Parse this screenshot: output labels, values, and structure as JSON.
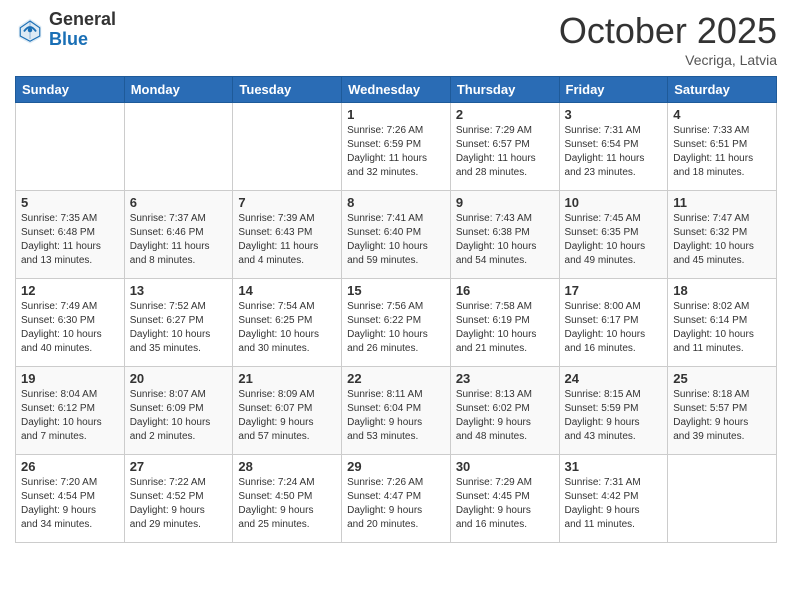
{
  "header": {
    "logo_general": "General",
    "logo_blue": "Blue",
    "month_title": "October 2025",
    "location": "Vecriga, Latvia"
  },
  "days_of_week": [
    "Sunday",
    "Monday",
    "Tuesday",
    "Wednesday",
    "Thursday",
    "Friday",
    "Saturday"
  ],
  "weeks": [
    [
      {
        "day": "",
        "info": ""
      },
      {
        "day": "",
        "info": ""
      },
      {
        "day": "",
        "info": ""
      },
      {
        "day": "1",
        "info": "Sunrise: 7:26 AM\nSunset: 6:59 PM\nDaylight: 11 hours\nand 32 minutes."
      },
      {
        "day": "2",
        "info": "Sunrise: 7:29 AM\nSunset: 6:57 PM\nDaylight: 11 hours\nand 28 minutes."
      },
      {
        "day": "3",
        "info": "Sunrise: 7:31 AM\nSunset: 6:54 PM\nDaylight: 11 hours\nand 23 minutes."
      },
      {
        "day": "4",
        "info": "Sunrise: 7:33 AM\nSunset: 6:51 PM\nDaylight: 11 hours\nand 18 minutes."
      }
    ],
    [
      {
        "day": "5",
        "info": "Sunrise: 7:35 AM\nSunset: 6:48 PM\nDaylight: 11 hours\nand 13 minutes."
      },
      {
        "day": "6",
        "info": "Sunrise: 7:37 AM\nSunset: 6:46 PM\nDaylight: 11 hours\nand 8 minutes."
      },
      {
        "day": "7",
        "info": "Sunrise: 7:39 AM\nSunset: 6:43 PM\nDaylight: 11 hours\nand 4 minutes."
      },
      {
        "day": "8",
        "info": "Sunrise: 7:41 AM\nSunset: 6:40 PM\nDaylight: 10 hours\nand 59 minutes."
      },
      {
        "day": "9",
        "info": "Sunrise: 7:43 AM\nSunset: 6:38 PM\nDaylight: 10 hours\nand 54 minutes."
      },
      {
        "day": "10",
        "info": "Sunrise: 7:45 AM\nSunset: 6:35 PM\nDaylight: 10 hours\nand 49 minutes."
      },
      {
        "day": "11",
        "info": "Sunrise: 7:47 AM\nSunset: 6:32 PM\nDaylight: 10 hours\nand 45 minutes."
      }
    ],
    [
      {
        "day": "12",
        "info": "Sunrise: 7:49 AM\nSunset: 6:30 PM\nDaylight: 10 hours\nand 40 minutes."
      },
      {
        "day": "13",
        "info": "Sunrise: 7:52 AM\nSunset: 6:27 PM\nDaylight: 10 hours\nand 35 minutes."
      },
      {
        "day": "14",
        "info": "Sunrise: 7:54 AM\nSunset: 6:25 PM\nDaylight: 10 hours\nand 30 minutes."
      },
      {
        "day": "15",
        "info": "Sunrise: 7:56 AM\nSunset: 6:22 PM\nDaylight: 10 hours\nand 26 minutes."
      },
      {
        "day": "16",
        "info": "Sunrise: 7:58 AM\nSunset: 6:19 PM\nDaylight: 10 hours\nand 21 minutes."
      },
      {
        "day": "17",
        "info": "Sunrise: 8:00 AM\nSunset: 6:17 PM\nDaylight: 10 hours\nand 16 minutes."
      },
      {
        "day": "18",
        "info": "Sunrise: 8:02 AM\nSunset: 6:14 PM\nDaylight: 10 hours\nand 11 minutes."
      }
    ],
    [
      {
        "day": "19",
        "info": "Sunrise: 8:04 AM\nSunset: 6:12 PM\nDaylight: 10 hours\nand 7 minutes."
      },
      {
        "day": "20",
        "info": "Sunrise: 8:07 AM\nSunset: 6:09 PM\nDaylight: 10 hours\nand 2 minutes."
      },
      {
        "day": "21",
        "info": "Sunrise: 8:09 AM\nSunset: 6:07 PM\nDaylight: 9 hours\nand 57 minutes."
      },
      {
        "day": "22",
        "info": "Sunrise: 8:11 AM\nSunset: 6:04 PM\nDaylight: 9 hours\nand 53 minutes."
      },
      {
        "day": "23",
        "info": "Sunrise: 8:13 AM\nSunset: 6:02 PM\nDaylight: 9 hours\nand 48 minutes."
      },
      {
        "day": "24",
        "info": "Sunrise: 8:15 AM\nSunset: 5:59 PM\nDaylight: 9 hours\nand 43 minutes."
      },
      {
        "day": "25",
        "info": "Sunrise: 8:18 AM\nSunset: 5:57 PM\nDaylight: 9 hours\nand 39 minutes."
      }
    ],
    [
      {
        "day": "26",
        "info": "Sunrise: 7:20 AM\nSunset: 4:54 PM\nDaylight: 9 hours\nand 34 minutes."
      },
      {
        "day": "27",
        "info": "Sunrise: 7:22 AM\nSunset: 4:52 PM\nDaylight: 9 hours\nand 29 minutes."
      },
      {
        "day": "28",
        "info": "Sunrise: 7:24 AM\nSunset: 4:50 PM\nDaylight: 9 hours\nand 25 minutes."
      },
      {
        "day": "29",
        "info": "Sunrise: 7:26 AM\nSunset: 4:47 PM\nDaylight: 9 hours\nand 20 minutes."
      },
      {
        "day": "30",
        "info": "Sunrise: 7:29 AM\nSunset: 4:45 PM\nDaylight: 9 hours\nand 16 minutes."
      },
      {
        "day": "31",
        "info": "Sunrise: 7:31 AM\nSunset: 4:42 PM\nDaylight: 9 hours\nand 11 minutes."
      },
      {
        "day": "",
        "info": ""
      }
    ]
  ]
}
